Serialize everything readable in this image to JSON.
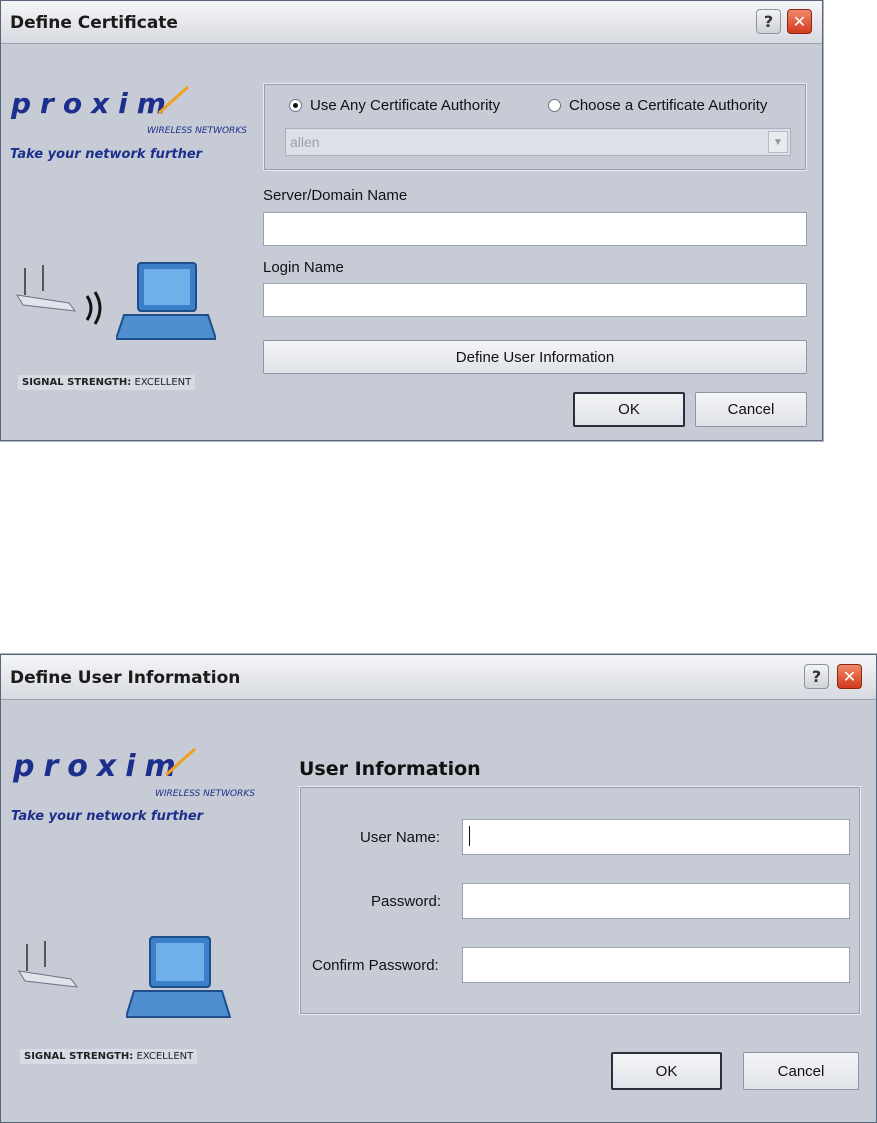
{
  "dialog1": {
    "title": "Define Certificate",
    "help_glyph": "?",
    "close_glyph": "✕",
    "logo": {
      "wordmark": "proxim",
      "subtitle": "WIRELESS NETWORKS",
      "tagline": "Take your network further"
    },
    "signal": {
      "label": "SIGNAL STRENGTH:",
      "value": "EXCELLENT"
    },
    "ca_options": [
      {
        "label": "Use Any Certificate Authority",
        "selected": true
      },
      {
        "label": "Choose a Certificate Authority",
        "selected": false
      }
    ],
    "ca_select_value": "allen",
    "server_label": "Server/Domain Name",
    "server_value": "",
    "login_label": "Login Name",
    "login_value": "",
    "define_user_button": "Define User Information",
    "ok_button": "OK",
    "cancel_button": "Cancel"
  },
  "dialog2": {
    "title": "Define User Information",
    "help_glyph": "?",
    "close_glyph": "✕",
    "logo": {
      "wordmark": "proxim",
      "subtitle": "WIRELESS NETWORKS",
      "tagline": "Take your network further"
    },
    "signal": {
      "label": "SIGNAL STRENGTH:",
      "value": "EXCELLENT"
    },
    "section_title": "User Information",
    "fields": [
      {
        "label": "User Name:",
        "value": ""
      },
      {
        "label": "Password:",
        "value": ""
      },
      {
        "label": "Confirm Password:",
        "value": ""
      }
    ],
    "ok_button": "OK",
    "cancel_button": "Cancel"
  },
  "icons": [
    "help-icon",
    "close-icon",
    "router-icon",
    "laptop-icon",
    "signal-waves-icon",
    "dropdown-arrow-icon"
  ]
}
